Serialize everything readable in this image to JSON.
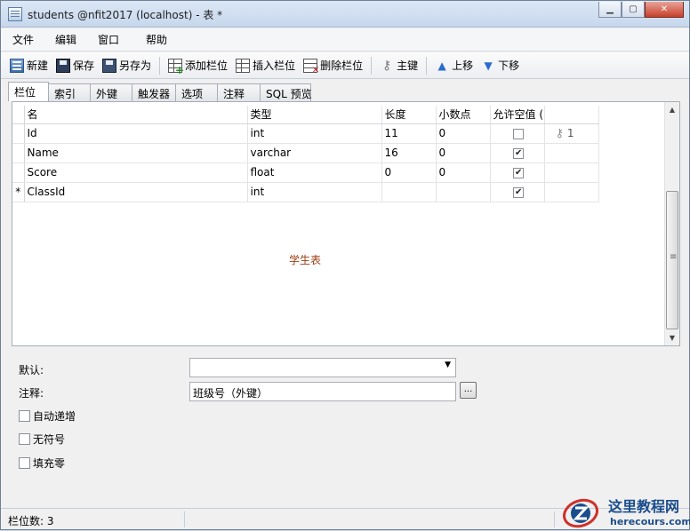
{
  "window": {
    "title": "students @nfit2017 (localhost) - 表 *",
    "minimize_glyph": "▁",
    "maximize_glyph": "▢",
    "close_glyph": "✕"
  },
  "menu": [
    "文件",
    "编辑",
    "窗口",
    "帮助"
  ],
  "toolbar": {
    "new": "新建",
    "save": "保存",
    "save_as": "另存为",
    "add_field": "添加栏位",
    "insert_field": "插入栏位",
    "delete_field": "删除栏位",
    "primary_key": "主键",
    "move_up": "上移",
    "move_down": "下移"
  },
  "tabs": [
    "栏位",
    "索引",
    "外键",
    "触发器",
    "选项",
    "注释",
    "SQL 预览"
  ],
  "grid": {
    "headers": {
      "name": "名",
      "type": "类型",
      "length": "长度",
      "decimals": "小数点",
      "allow_null": "允许空值 ("
    },
    "rows": [
      {
        "marker": "",
        "name": "Id",
        "type": "int",
        "length": "11",
        "decimals": "0",
        "allow_null": false,
        "key": "1"
      },
      {
        "marker": "",
        "name": "Name",
        "type": "varchar",
        "length": "16",
        "decimals": "0",
        "allow_null": true,
        "key": ""
      },
      {
        "marker": "",
        "name": "Score",
        "type": "float",
        "length": "0",
        "decimals": "0",
        "allow_null": true,
        "key": ""
      },
      {
        "marker": "*",
        "name": "ClassId",
        "type": "int",
        "length": "",
        "decimals": "",
        "allow_null": true,
        "key": ""
      }
    ],
    "table_comment": "学生表"
  },
  "properties": {
    "default_label": "默认:",
    "default_value": "",
    "comment_label": "注释:",
    "comment_value": "班级号（外键）",
    "ellipsis": "...",
    "auto_increment": "自动递增",
    "unsigned": "无符号",
    "zerofill": "填充零"
  },
  "status": {
    "field_count": "栏位数: 3"
  },
  "watermark": {
    "title": "这里教程网",
    "url": "herecours.com"
  },
  "colors": {
    "comment_text": "#9c3d12",
    "watermark_blue": "#1b4d8c",
    "watermark_red": "#d0302a"
  }
}
